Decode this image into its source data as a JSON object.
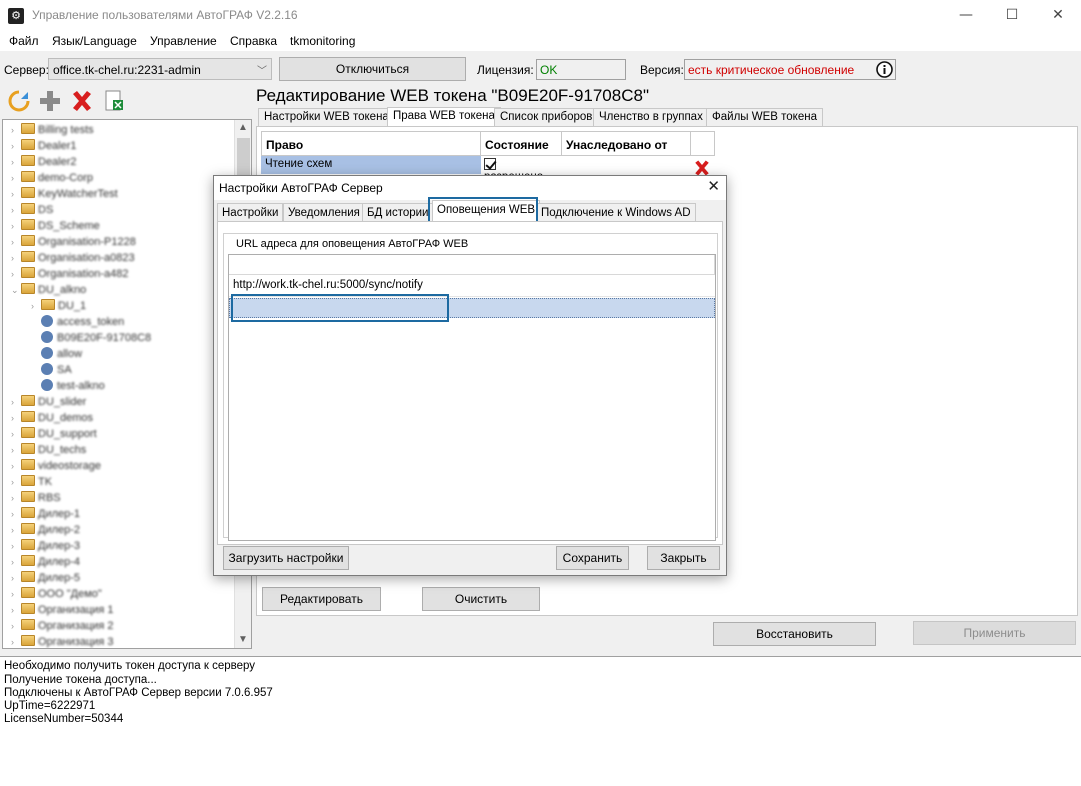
{
  "window": {
    "title": "Управление пользователями АвтоГРАФ V2.2.16",
    "controls": {
      "minimize": "—",
      "maximize": "☐",
      "close": "✕"
    }
  },
  "menu": [
    "Файл",
    "Язык/Language",
    "Управление",
    "Справка",
    "tkmonitoring"
  ],
  "connection": {
    "server_label": "Сервер:",
    "server_value": "office.tk-chel.ru:2231-admin",
    "disconnect_label": "Отключиться",
    "license_label": "Лицензия:",
    "license_value": "OK",
    "version_label": "Версия:",
    "version_value": "есть критическое обновление",
    "colors": {
      "license_ok": "#008000",
      "version_warning": "#d00000"
    }
  },
  "tree": {
    "items": [
      "Billing tests",
      "Dealer1",
      "Dealer2",
      "demo-Corp",
      "KeyWatcherTest",
      "DS",
      "DS_Scheme",
      "Organisation-P1228",
      "Organisation-a0823",
      "Organisation-a482",
      "DU_alkno",
      "DU_1",
      "access_token",
      "B09E20F-91708C8",
      "allow",
      "SA",
      "test-alkno",
      "DU_slider",
      "DU_demos",
      "DU_support",
      "DU_techs",
      "videostorage",
      "TK",
      "RBS",
      "Дилер-1",
      "Дилер-2",
      "Дилер-3",
      "Дилер-4",
      "Дилер-5",
      "ООО \"Демо\"",
      "Организация 1",
      "Организация 2",
      "Организация 3"
    ]
  },
  "editor": {
    "title": "Редактирование WEB токена \"B09E20F-91708C8\"",
    "tabs": [
      "Настройки WEB токена",
      "Права WEB токена",
      "Список приборов",
      "Членство в группах",
      "Файлы WEB токена"
    ],
    "grid": {
      "headers": [
        "Право",
        "Состояние",
        "Унаследовано от"
      ],
      "rows": [
        {
          "right": "Чтение схем",
          "state": "разрешено",
          "inherited": ""
        }
      ]
    },
    "edit_button": "Редактировать",
    "clear_button": "Очистить",
    "restore_button": "Восстановить",
    "apply_button": "Применить"
  },
  "dialog": {
    "title": "Настройки АвтоГРАФ Сервер",
    "close": "✕",
    "tabs": [
      "Настройки",
      "Уведомления",
      "БД истории",
      "Оповещения WEB",
      "Подключение к Windows AD"
    ],
    "group_title": "URL адреса для оповещения АвтоГРАФ WEB",
    "urls": [
      "http://work.tk-chel.ru:5000/sync/notify"
    ],
    "load_button": "Загрузить настройки",
    "save_button": "Сохранить",
    "close_button": "Закрыть",
    "colors": {
      "highlight": "#1d6aa1"
    }
  },
  "log": [
    "Необходимо получить токен доступа к серверу",
    "Получение токена доступа...",
    "Подключены к АвтоГРАФ Сервер версии 7.0.6.957",
    "UpTime=6222971",
    "LicenseNumber=50344"
  ]
}
